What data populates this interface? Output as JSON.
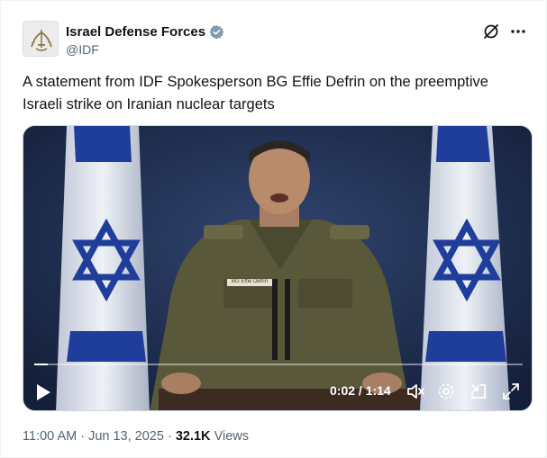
{
  "author": {
    "display_name": "Israel Defense Forces",
    "handle": "@IDF",
    "verified": true,
    "verified_color": "#829aab"
  },
  "tweet": {
    "text": "A statement from IDF Spokesperson BG Effie Defrin on the preemptive Israeli strike on Iranian nuclear targets"
  },
  "video": {
    "time_display": "0:02 / 1:14",
    "progress_fraction": 0.027,
    "name_tag": "BG Effie Defrin",
    "icons": [
      "play-icon",
      "mute-icon",
      "settings-icon",
      "dock-icon",
      "fullscreen-icon"
    ]
  },
  "footer": {
    "timestamp": "11:00 AM · Jun 13, 2025",
    "separator": " · ",
    "views_count": "32.1K",
    "views_label": "Views"
  },
  "icons": {
    "header_actions": [
      "grok-icon",
      "more-icon"
    ]
  },
  "colors": {
    "text_primary": "#0f1419",
    "text_secondary": "#536471",
    "flag_blue": "#1f3d9a",
    "backdrop": "#1c2a4a"
  }
}
